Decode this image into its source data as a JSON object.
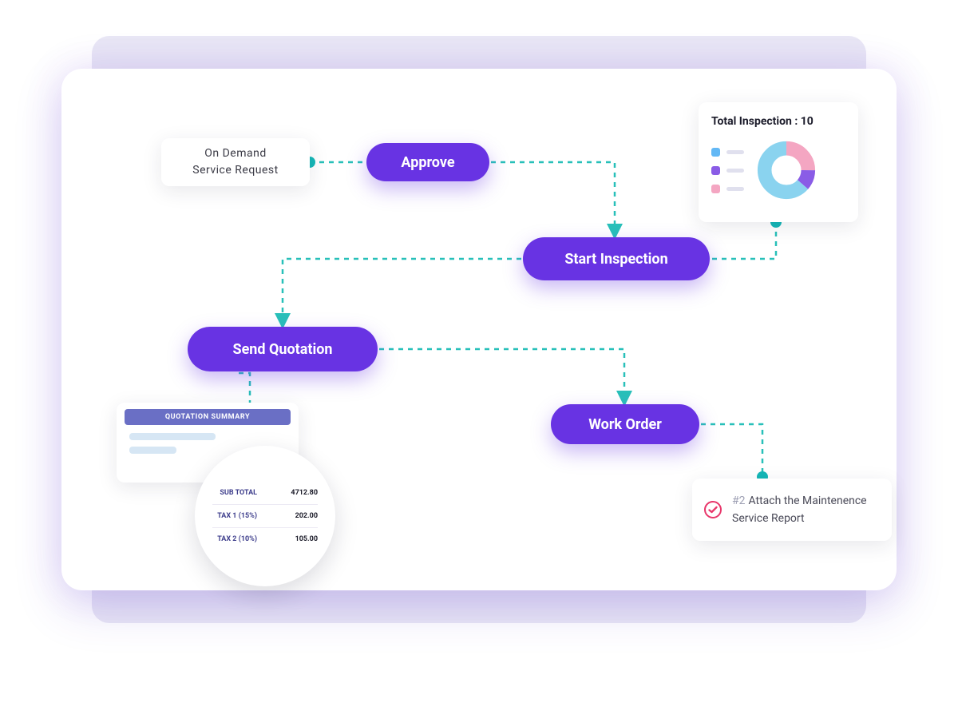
{
  "flow": {
    "service_request_label": "On Demand\nService Request",
    "approve_label": "Approve",
    "start_inspection_label": "Start Inspection",
    "send_quotation_label": "Send Quotation",
    "work_order_label": "Work Order"
  },
  "inspection_widget": {
    "title": "Total Inspection : 10",
    "legend_colors": [
      "#63b8f5",
      "#8a5ce6",
      "#f4a6c2"
    ]
  },
  "quotation_summary": {
    "header": "QUOTATION SUMMARY",
    "rows": [
      {
        "label": "SUB TOTAL",
        "value": "4712.80"
      },
      {
        "label": "TAX 1 (15%)",
        "value": "202.00"
      },
      {
        "label": "TAX 2 (10%)",
        "value": "105.00"
      }
    ]
  },
  "attach_task": {
    "number": "#2",
    "text": "Attach the Maintenence Service Report"
  },
  "colors": {
    "primary": "#6833e3",
    "connector": "#28c0b9"
  }
}
